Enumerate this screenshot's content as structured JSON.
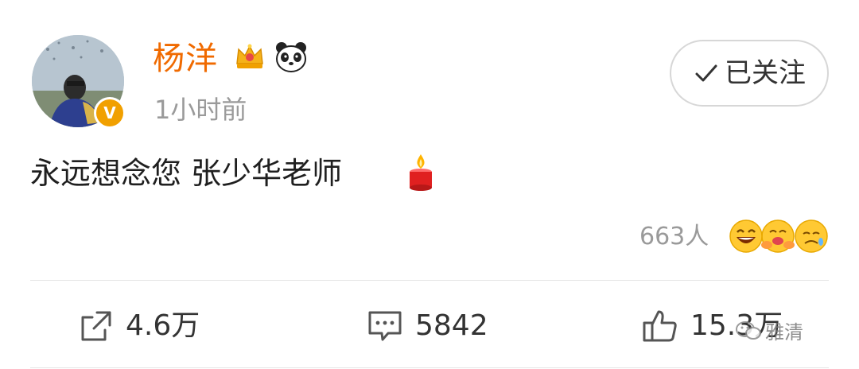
{
  "user": {
    "name": "杨洋",
    "verified_badge": "V",
    "time": "1小时前",
    "badges": [
      "crown-icon",
      "panda-icon"
    ]
  },
  "follow": {
    "label": "已关注",
    "icon": "check-icon"
  },
  "post": {
    "text": "永远想念您 张少华老师",
    "emoji": "candle-icon"
  },
  "reactions": {
    "count": "663人",
    "faces": [
      "laugh-icon",
      "hug-icon",
      "sad-icon"
    ]
  },
  "actions": {
    "share_count": "4.6万",
    "comment_count": "5842",
    "like_count": "15.3万"
  },
  "watermark": {
    "text": "雅清"
  },
  "colors": {
    "username": "#f06a00",
    "meta": "#9a9a9a",
    "verified": "#f1a000"
  }
}
